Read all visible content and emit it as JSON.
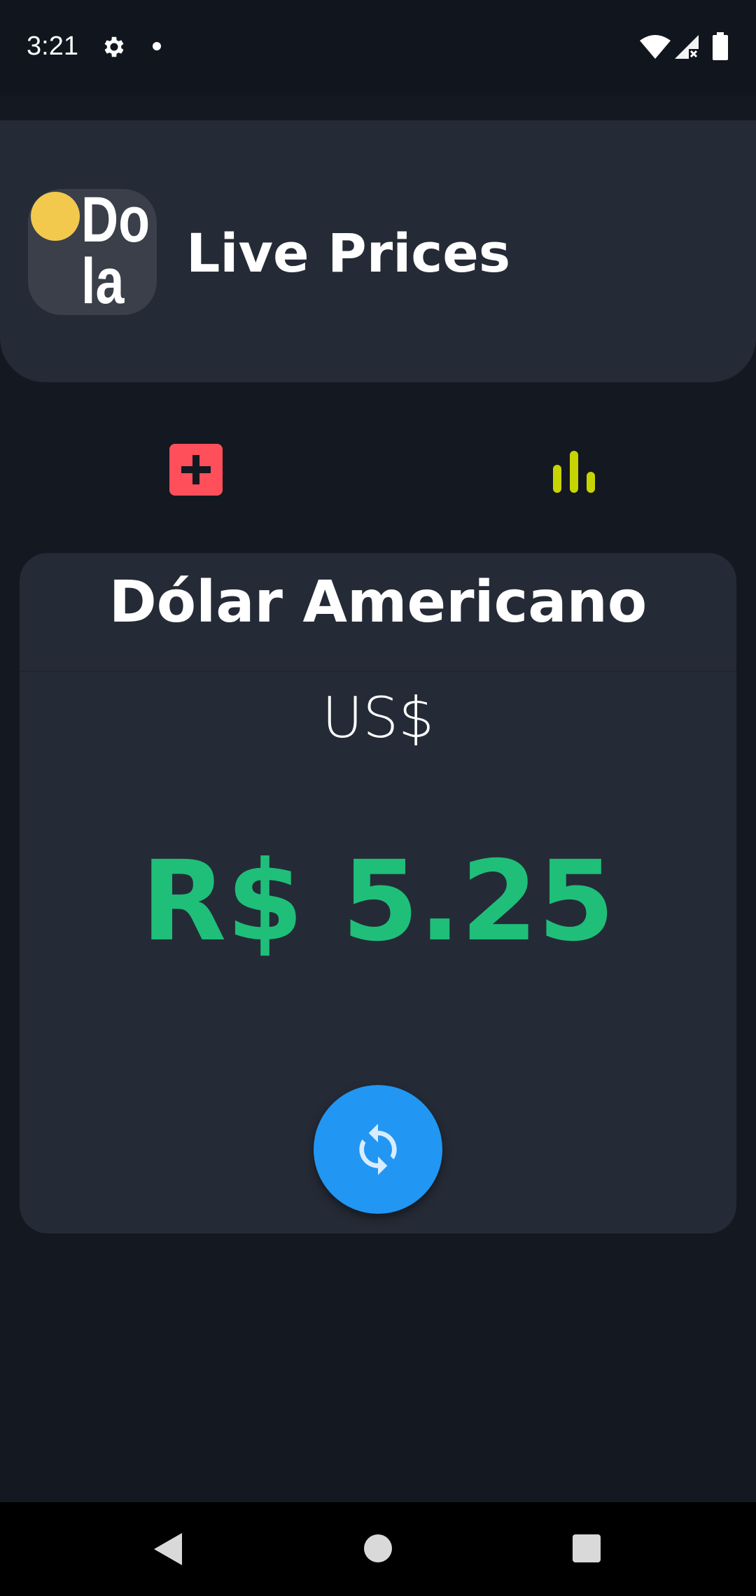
{
  "status_bar": {
    "time": "3:21",
    "icons": [
      "gear-icon",
      "notification-dot-icon",
      "wifi-icon",
      "signal-icon",
      "battery-icon"
    ]
  },
  "header": {
    "logo_line1": "Do",
    "logo_line2": "la",
    "title": "Live Prices"
  },
  "toolbar": {
    "add_icon": "plus-icon",
    "chart_icon": "bar-chart-icon"
  },
  "currency_card": {
    "name": "Dólar Americano",
    "symbol": "US$",
    "price": "R$ 5.25",
    "refresh_icon": "refresh-icon"
  },
  "colors": {
    "background": "#141821",
    "surface": "#252b36",
    "price_green": "#1fbf7a",
    "add_red": "#ff4f5a",
    "chart_yellow": "#c8d400",
    "refresh_blue": "#2196f3",
    "logo_coin": "#f2c94c"
  },
  "nav_bar": {
    "icons": [
      "back-icon",
      "home-icon",
      "recents-icon"
    ]
  }
}
